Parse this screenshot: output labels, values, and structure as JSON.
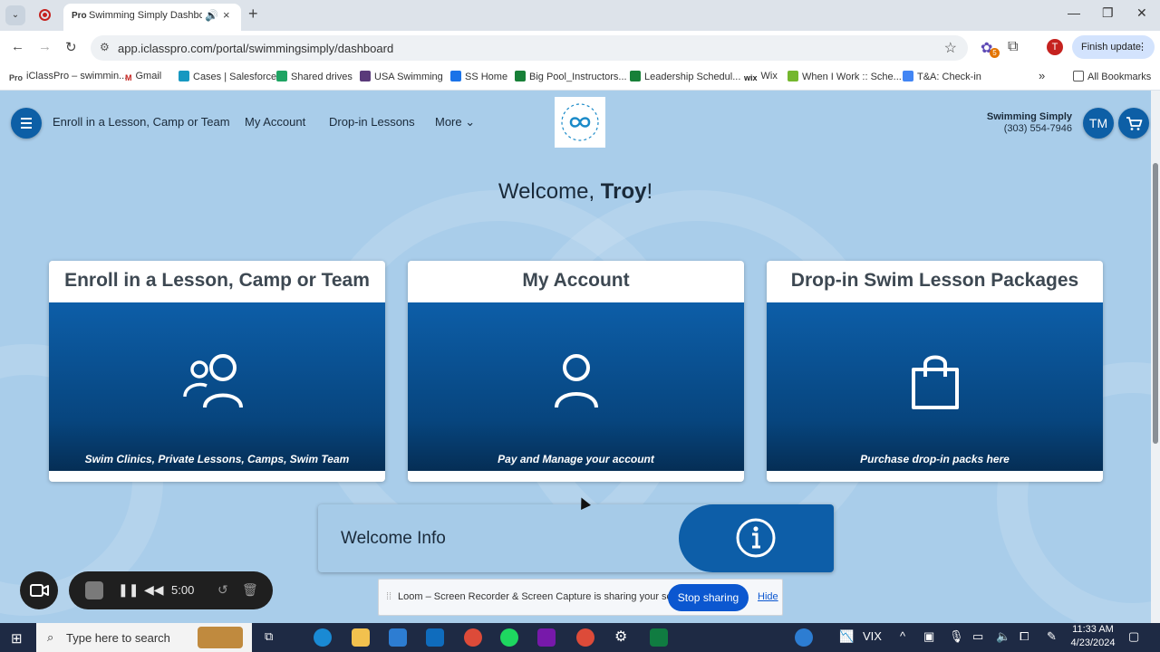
{
  "browser": {
    "tab": {
      "favicon_text": "Pro",
      "title": "Swimming Simply Dashboard",
      "audio_icon": "speaker-icon",
      "close": "×"
    },
    "new_tab": "+",
    "url": "app.iclasspro.com/portal/swimmingsimply/dashboard",
    "profile_initial": "T",
    "extension_badge": "5",
    "update_button": "Finish update",
    "bookmarks": [
      {
        "label": "iClassPro – swimmin...",
        "prefix": "Pro",
        "color": "#444444"
      },
      {
        "label": "Gmail",
        "prefix": "M",
        "color": "#c5221f"
      },
      {
        "label": "Cases | Salesforce",
        "prefix": "",
        "color": "#1798c1"
      },
      {
        "label": "Shared drives",
        "prefix": "",
        "color": "#1fa463"
      },
      {
        "label": "USA Swimming",
        "prefix": "",
        "color": "#5a3a7a"
      },
      {
        "label": "SS Home",
        "prefix": "",
        "color": "#1a73e8"
      },
      {
        "label": "Big Pool_Instructors...",
        "prefix": "",
        "color": "#188038"
      },
      {
        "label": "Leadership Schedul...",
        "prefix": "",
        "color": "#188038"
      },
      {
        "label": "Wix",
        "prefix": "wix",
        "color": "#222222"
      },
      {
        "label": "When I Work :: Sche...",
        "prefix": "",
        "color": "#74b72e"
      },
      {
        "label": "T&A: Check-in",
        "prefix": "",
        "color": "#4285f4"
      }
    ],
    "all_bookmarks": "All Bookmarks"
  },
  "site": {
    "nav": [
      "Enroll in a Lesson, Camp or Team",
      "My Account",
      "Drop-in Lessons",
      "More"
    ],
    "brand_name": "Swimming Simply",
    "brand_phone": "(303) 554-7946",
    "user_initials": "TM",
    "welcome_prefix": "Welcome, ",
    "welcome_name": "Troy",
    "welcome_suffix": "!",
    "cards": [
      {
        "title": "Enroll in a Lesson, Camp or Team",
        "subtitle": "Swim Clinics, Private Lessons, Camps, Swim Team",
        "icon": "users-icon"
      },
      {
        "title": "My Account",
        "subtitle": "Pay and Manage your account",
        "icon": "user-icon"
      },
      {
        "title": "Drop-in Swim Lesson Packages",
        "subtitle": "Purchase drop-in packs here",
        "icon": "shopping-bag-icon"
      }
    ],
    "welcome_info": "Welcome Info",
    "accent_color": "#0d5fa6"
  },
  "loom": {
    "timer": "5:00",
    "share_message": "Loom – Screen Recorder & Screen Capture is sharing your screen.",
    "stop_sharing": "Stop sharing",
    "hide": "Hide"
  },
  "taskbar": {
    "search_placeholder": "Type here to search",
    "vix_label": "VIX",
    "time": "11:33 AM",
    "date": "4/23/2024"
  }
}
